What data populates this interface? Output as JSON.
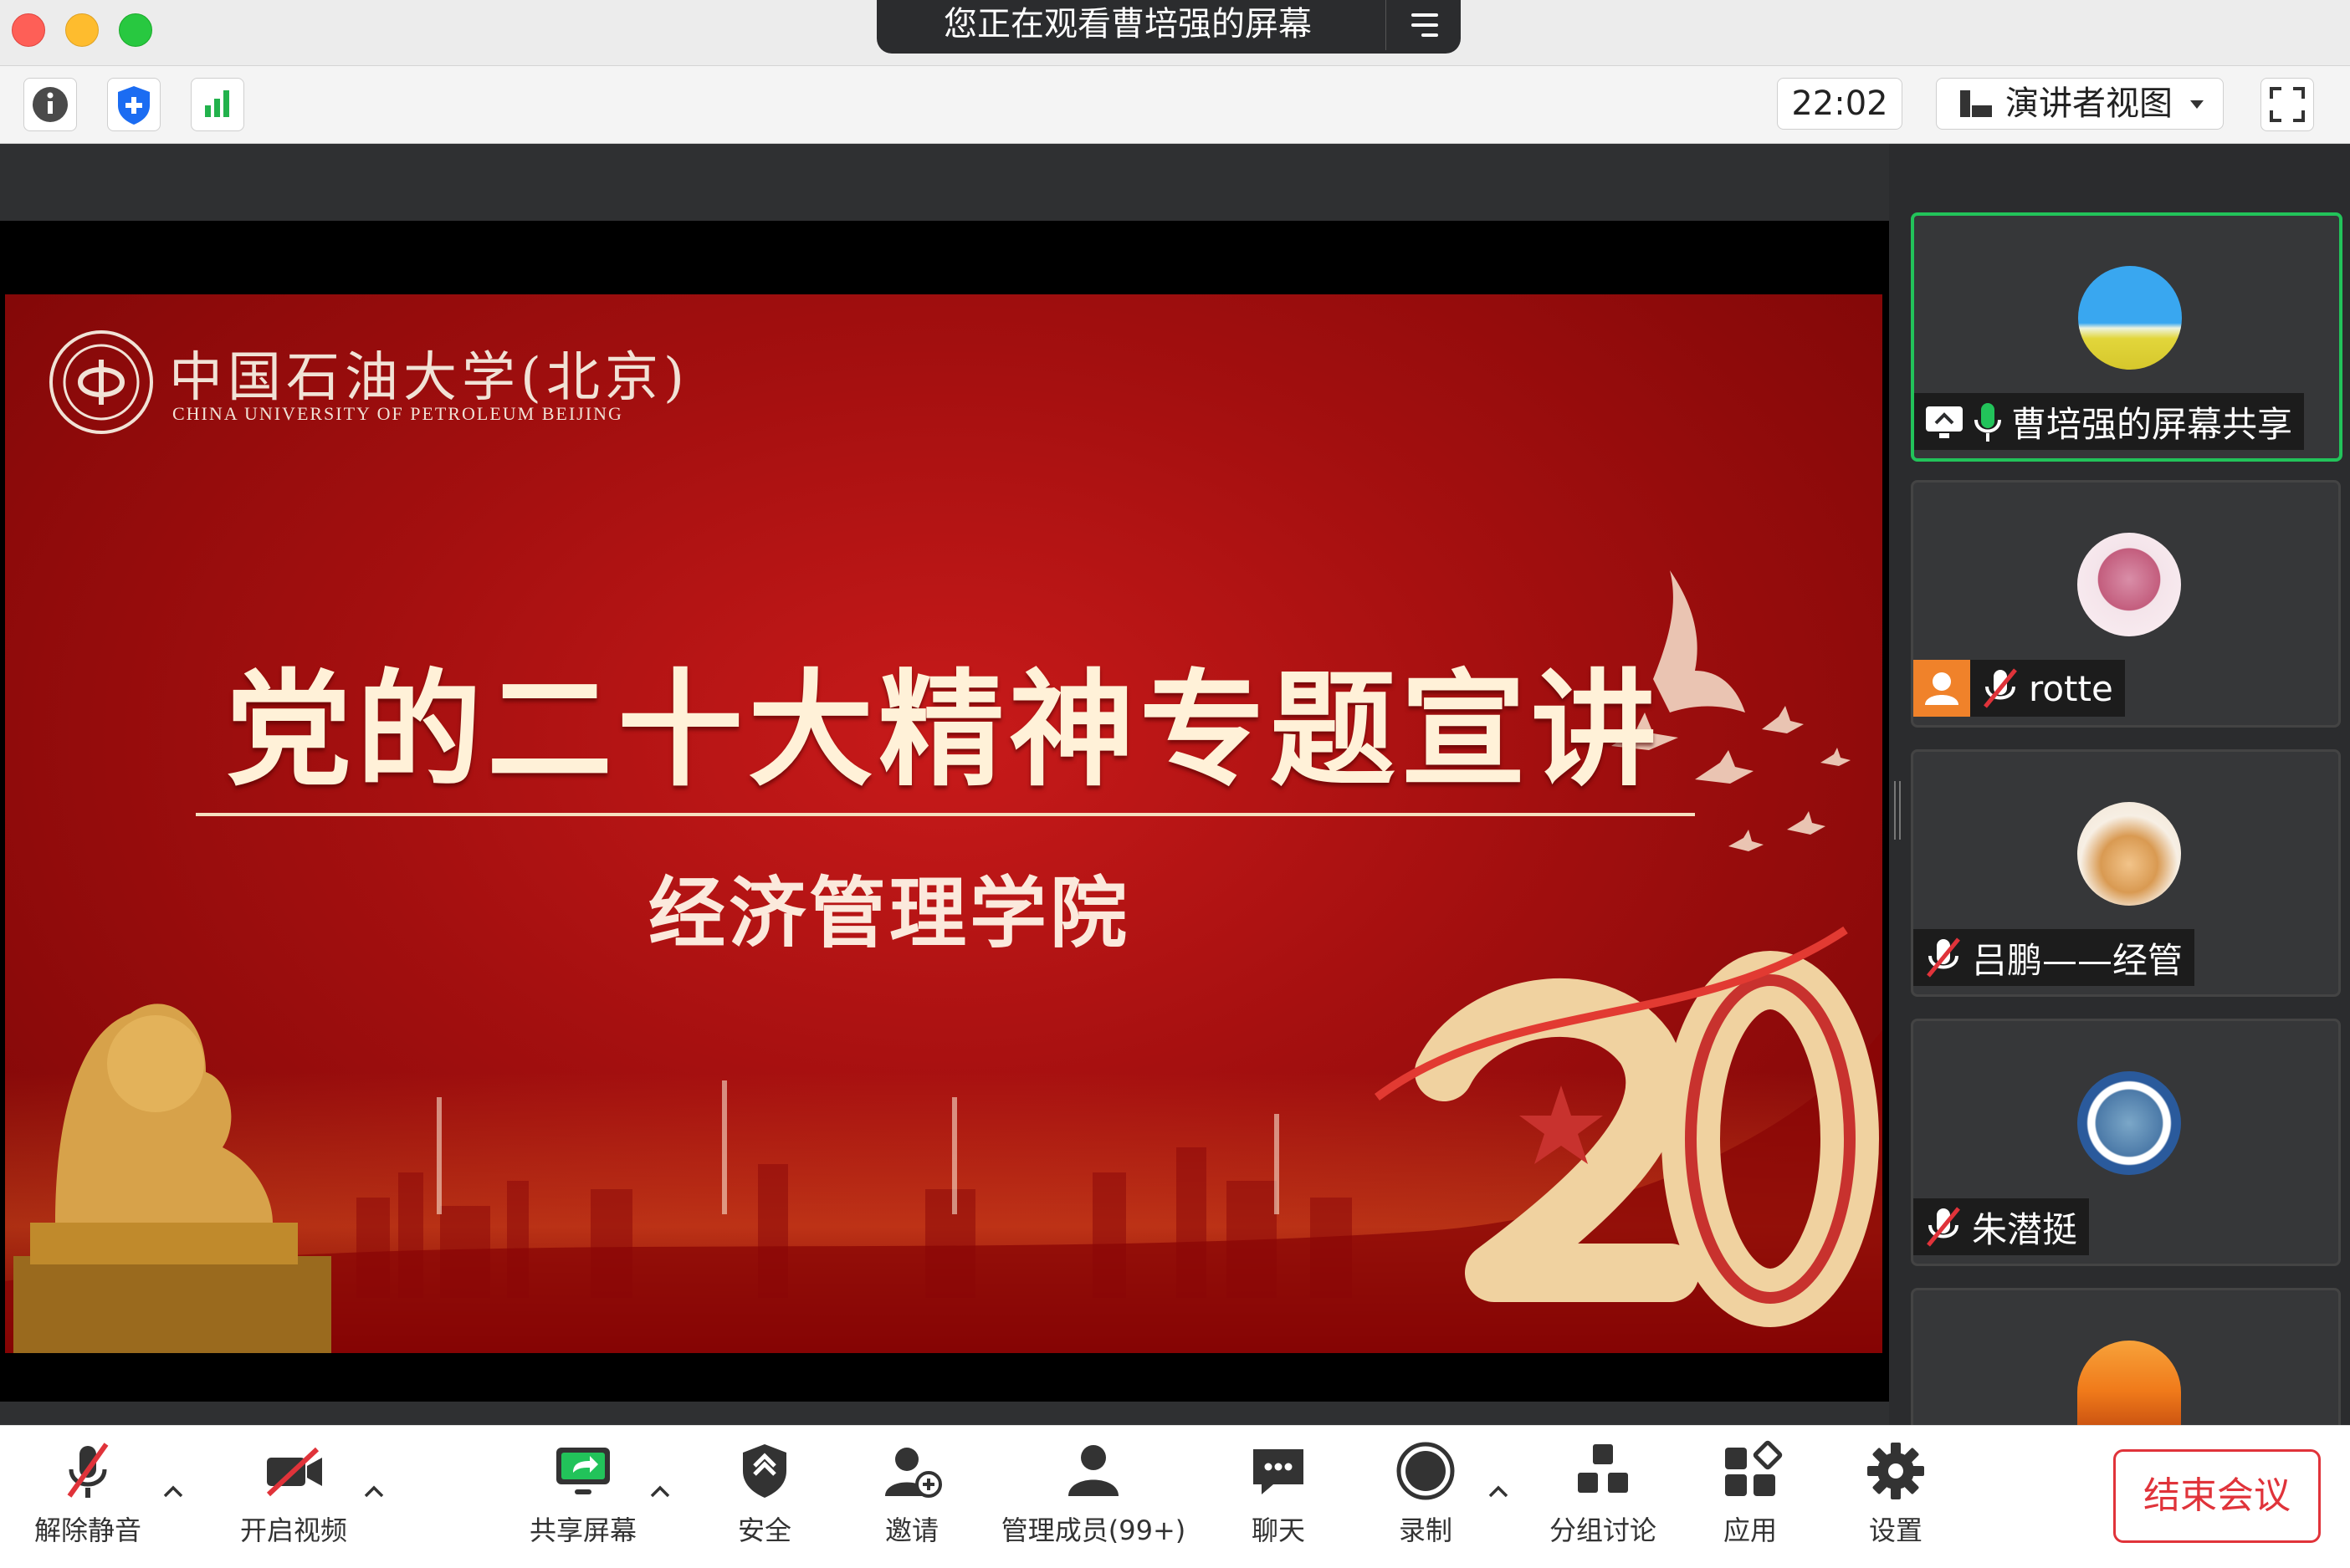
{
  "window": {
    "banner_text": "您正在观看曹培强的屏幕"
  },
  "toolbar": {
    "timer": "22:02",
    "view_mode": "演讲者视图"
  },
  "slide": {
    "university_cn": "中国石油大学(北京)",
    "university_en": "CHINA UNIVERSITY OF PETROLEUM BEIJING",
    "title": "党的二十大精神专题宣讲",
    "subtitle": "经济管理学院",
    "emblem_number": "20"
  },
  "participants": [
    {
      "name": "曹培强的屏幕共享",
      "status": "sharing",
      "mic": "on"
    },
    {
      "name": "rotte",
      "status": "host",
      "mic": "muted"
    },
    {
      "name": "吕鹏——经管",
      "mic": "muted"
    },
    {
      "name": "朱潜挺",
      "mic": "muted"
    },
    {
      "name": ""
    }
  ],
  "controls": {
    "unmute": "解除静音",
    "start_video": "开启视频",
    "share_screen": "共享屏幕",
    "security": "安全",
    "invite": "邀请",
    "participants": "管理成员(99+)",
    "chat": "聊天",
    "record": "录制",
    "breakout": "分组讨论",
    "apps": "应用",
    "settings": "设置",
    "end_meeting": "结束会议"
  },
  "colors": {
    "accent_green": "#22c35a",
    "end_red": "#e0333a",
    "slide_red": "#b01414"
  }
}
